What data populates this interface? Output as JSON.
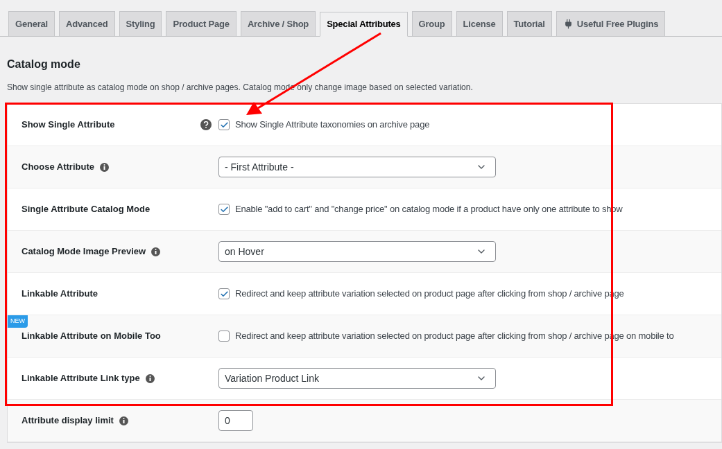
{
  "tabs": [
    {
      "label": "General",
      "selected": false
    },
    {
      "label": "Advanced",
      "selected": false
    },
    {
      "label": "Styling",
      "selected": false
    },
    {
      "label": "Product Page",
      "selected": false
    },
    {
      "label": "Archive / Shop",
      "selected": false
    },
    {
      "label": "Special Attributes",
      "selected": true
    },
    {
      "label": "Group",
      "selected": false
    },
    {
      "label": "License",
      "selected": false
    },
    {
      "label": "Tutorial",
      "selected": false
    },
    {
      "label": "Useful Free Plugins",
      "selected": false,
      "icon": {
        "kind": "plug"
      }
    }
  ],
  "section": {
    "title": "Catalog mode",
    "description": "Show single attribute as catalog mode on shop / archive pages. Catalog mode only change image based on selected variation."
  },
  "settings": [
    {
      "label": "Show Single Attribute",
      "help": {
        "kind": "question"
      },
      "kind": "checkbox",
      "checked": true,
      "text": "Show Single Attribute taxonomies on archive page"
    },
    {
      "label": "Choose Attribute",
      "help": {
        "kind": "info"
      },
      "kind": "select",
      "value": "- First Attribute -"
    },
    {
      "label": "Single Attribute Catalog Mode",
      "kind": "checkbox",
      "checked": true,
      "text": "Enable \"add to cart\" and \"change price\" on catalog mode if a product have only one attribute to show"
    },
    {
      "label": "Catalog Mode Image Preview",
      "help": {
        "kind": "info"
      },
      "kind": "select",
      "value": "on Hover"
    },
    {
      "label": "Linkable Attribute",
      "kind": "checkbox",
      "checked": true,
      "text": "Redirect and keep attribute variation selected on product page after clicking from shop / archive page"
    },
    {
      "label": "Linkable Attribute on Mobile Too",
      "badge": "NEW",
      "kind": "checkbox",
      "checked": false,
      "text": "Redirect and keep attribute variation selected on product page after clicking from shop / archive page on mobile to"
    },
    {
      "label": "Linkable Attribute Link type",
      "help": {
        "kind": "info"
      },
      "kind": "select",
      "value": "Variation Product Link"
    },
    {
      "label": "Attribute display limit",
      "help": {
        "kind": "info"
      },
      "kind": "number",
      "value": "0"
    }
  ]
}
